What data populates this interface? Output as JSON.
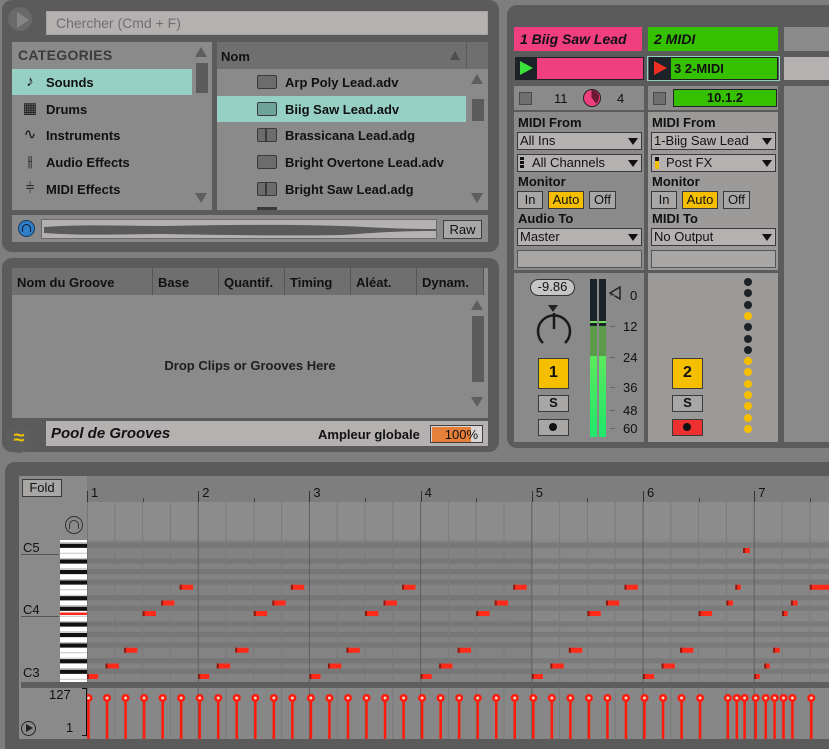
{
  "browser": {
    "search_placeholder": "Chercher (Cmd + F)",
    "categories_header": "CATEGORIES",
    "categories": [
      {
        "label": "Sounds",
        "icon": "note-icon",
        "selected": true
      },
      {
        "label": "Drums",
        "icon": "grid-icon",
        "selected": false
      },
      {
        "label": "Instruments",
        "icon": "wave-icon",
        "selected": false
      },
      {
        "label": "Audio Effects",
        "icon": "audio-fx-icon",
        "selected": false
      },
      {
        "label": "MIDI Effects",
        "icon": "midi-fx-icon",
        "selected": false
      }
    ],
    "files_header": "Nom",
    "files": [
      {
        "label": "Arp Poly Lead.adv",
        "type": "preset",
        "selected": false
      },
      {
        "label": "Biig Saw Lead.adv",
        "type": "preset",
        "selected": true
      },
      {
        "label": "Brassicana Lead.adg",
        "type": "rack",
        "selected": false
      },
      {
        "label": "Bright Overtone Lead.adv",
        "type": "preset",
        "selected": false
      },
      {
        "label": "Bright Saw Lead.adg",
        "type": "rack",
        "selected": false
      }
    ],
    "raw_label": "Raw"
  },
  "groove": {
    "columns": [
      "Nom du Groove",
      "Base",
      "Quantif.",
      "Timing",
      "Aléat.",
      "Dynam."
    ],
    "drop_text": "Drop Clips or Grooves Here",
    "pool_title": "Pool de Grooves",
    "amp_label": "Ampleur globale",
    "amp_value": "100%",
    "amp_fill_fraction": 0.74
  },
  "mixer": {
    "tracks": [
      {
        "title": "1 Biig Saw Lead",
        "color": "#ef3f7f",
        "clip_name": "",
        "clip_play_color": "#3ce23c",
        "info_left": "11",
        "info_right": "4",
        "input_label": "MIDI From",
        "input_value": "All Ins",
        "channel_value": "All Channels",
        "monitor_label": "Monitor",
        "monitor_options": [
          "In",
          "Auto",
          "Off"
        ],
        "monitor_selected": "Auto",
        "output_label": "Audio To",
        "output_value": "Master",
        "volume": "-9.86",
        "number": "1",
        "solo": "S",
        "arm_active": false
      },
      {
        "title": "2 MIDI",
        "color": "#35c000",
        "clip_name": "3 2-MIDI",
        "clip_play_color": "#f03020",
        "position": "10.1.2",
        "input_label": "MIDI From",
        "input_value": "1-Biig Saw Lead",
        "channel_value": "Post FX",
        "monitor_label": "Monitor",
        "monitor_options": [
          "In",
          "Auto",
          "Off"
        ],
        "monitor_selected": "Auto",
        "output_label": "MIDI To",
        "output_value": "No Output",
        "number": "2",
        "solo": "S",
        "arm_active": true
      }
    ],
    "meter_scale": [
      "0",
      "12",
      "24",
      "36",
      "48",
      "60"
    ],
    "meter_level_fraction": 0.62,
    "meter_peak_fraction": 0.7,
    "midi_dots": [
      "off",
      "off",
      "off",
      "on",
      "off",
      "off",
      "off",
      "on",
      "on",
      "on",
      "on",
      "on",
      "on",
      "on"
    ]
  },
  "editor": {
    "fold_label": "Fold",
    "octave_labels": [
      "C5",
      "C4",
      "C3"
    ],
    "bar_numbers": [
      "1",
      "2",
      "3",
      "4",
      "5",
      "6",
      "7"
    ],
    "velocity_max": "127",
    "velocity_min": "1",
    "note_color": "#ff2a1a",
    "notes": [
      {
        "pitch": 48,
        "start": 0.0,
        "len": 0.1
      },
      {
        "pitch": 50,
        "start": 0.1667,
        "len": 0.12
      },
      {
        "pitch": 53,
        "start": 0.3333,
        "len": 0.12
      },
      {
        "pitch": 60,
        "start": 0.5,
        "len": 0.12
      },
      {
        "pitch": 62,
        "start": 0.6667,
        "len": 0.12
      },
      {
        "pitch": 65,
        "start": 0.8333,
        "len": 0.12
      },
      {
        "pitch": 48,
        "start": 1.0,
        "len": 0.1
      },
      {
        "pitch": 50,
        "start": 1.1667,
        "len": 0.12
      },
      {
        "pitch": 53,
        "start": 1.3333,
        "len": 0.12
      },
      {
        "pitch": 60,
        "start": 1.5,
        "len": 0.12
      },
      {
        "pitch": 62,
        "start": 1.6667,
        "len": 0.12
      },
      {
        "pitch": 65,
        "start": 1.8333,
        "len": 0.12
      },
      {
        "pitch": 48,
        "start": 2.0,
        "len": 0.1
      },
      {
        "pitch": 50,
        "start": 2.1667,
        "len": 0.12
      },
      {
        "pitch": 53,
        "start": 2.3333,
        "len": 0.12
      },
      {
        "pitch": 60,
        "start": 2.5,
        "len": 0.12
      },
      {
        "pitch": 62,
        "start": 2.6667,
        "len": 0.12
      },
      {
        "pitch": 65,
        "start": 2.8333,
        "len": 0.12
      },
      {
        "pitch": 48,
        "start": 3.0,
        "len": 0.1
      },
      {
        "pitch": 50,
        "start": 3.1667,
        "len": 0.12
      },
      {
        "pitch": 53,
        "start": 3.3333,
        "len": 0.12
      },
      {
        "pitch": 60,
        "start": 3.5,
        "len": 0.12
      },
      {
        "pitch": 62,
        "start": 3.6667,
        "len": 0.12
      },
      {
        "pitch": 65,
        "start": 3.8333,
        "len": 0.12
      },
      {
        "pitch": 48,
        "start": 4.0,
        "len": 0.1
      },
      {
        "pitch": 50,
        "start": 4.1667,
        "len": 0.12
      },
      {
        "pitch": 53,
        "start": 4.3333,
        "len": 0.12
      },
      {
        "pitch": 60,
        "start": 4.5,
        "len": 0.12
      },
      {
        "pitch": 62,
        "start": 4.6667,
        "len": 0.12
      },
      {
        "pitch": 65,
        "start": 4.8333,
        "len": 0.12
      },
      {
        "pitch": 48,
        "start": 5.0,
        "len": 0.1
      },
      {
        "pitch": 50,
        "start": 5.1667,
        "len": 0.12
      },
      {
        "pitch": 53,
        "start": 5.3333,
        "len": 0.12
      },
      {
        "pitch": 60,
        "start": 5.5,
        "len": 0.12
      },
      {
        "pitch": 62,
        "start": 5.75,
        "len": 0.06
      },
      {
        "pitch": 65,
        "start": 5.83,
        "len": 0.05
      },
      {
        "pitch": 72,
        "start": 5.9,
        "len": 0.06
      },
      {
        "pitch": 48,
        "start": 6.0,
        "len": 0.05
      },
      {
        "pitch": 50,
        "start": 6.09,
        "len": 0.05
      },
      {
        "pitch": 53,
        "start": 6.17,
        "len": 0.06
      },
      {
        "pitch": 60,
        "start": 6.25,
        "len": 0.05
      },
      {
        "pitch": 62,
        "start": 6.33,
        "len": 0.06
      },
      {
        "pitch": 65,
        "start": 6.5,
        "len": 0.2
      }
    ],
    "velocity_positions": [
      0,
      0.1667,
      0.3333,
      0.5,
      0.6667,
      0.8333,
      1,
      1.1667,
      1.3333,
      1.5,
      1.6667,
      1.8333,
      2,
      2.1667,
      2.3333,
      2.5,
      2.6667,
      2.8333,
      3,
      3.1667,
      3.3333,
      3.5,
      3.6667,
      3.8333,
      4,
      4.1667,
      4.3333,
      4.5,
      4.6667,
      4.8333,
      5,
      5.1667,
      5.3333,
      5.5,
      5.75,
      5.83,
      5.9,
      6.0,
      6.09,
      6.17,
      6.25,
      6.33,
      6.5
    ]
  }
}
